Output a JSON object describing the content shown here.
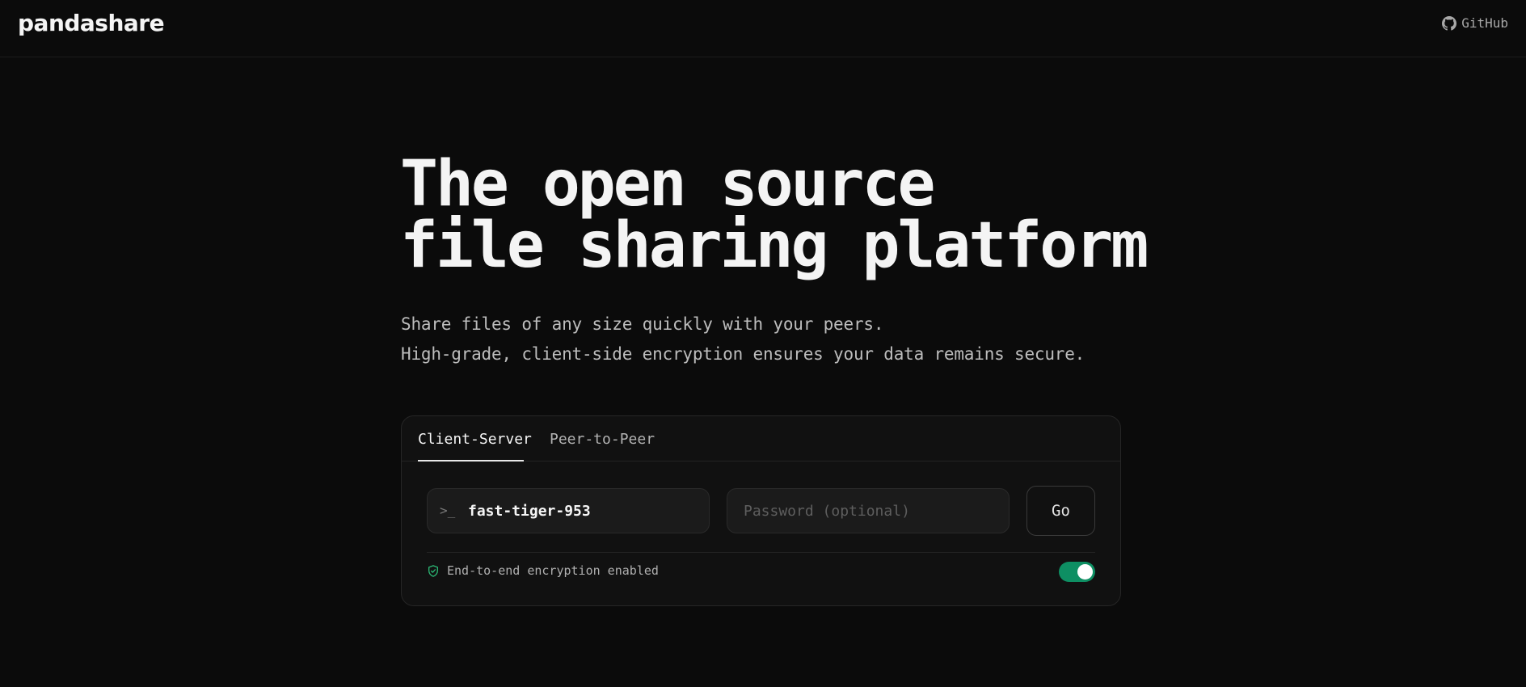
{
  "header": {
    "brand": "pandashare",
    "github_label": "GitHub",
    "github_icon": "github-icon"
  },
  "hero": {
    "title_line1": "The open source",
    "title_line2": "file sharing platform",
    "subtitle_line1": "Share files of any size quickly with your peers.",
    "subtitle_line2": "High-grade, client-side encryption ensures your data remains secure."
  },
  "card": {
    "tabs": [
      {
        "label": "Client-Server",
        "active": true
      },
      {
        "label": "Peer-to-Peer",
        "active": false
      }
    ],
    "code_field": {
      "icon": "terminal-prompt-icon",
      "prompt_glyph": ">_",
      "value": "fast-tiger-953"
    },
    "password_field": {
      "value": "",
      "placeholder": "Password (optional)"
    },
    "go_label": "Go",
    "encryption": {
      "icon": "shield-check-icon",
      "label": "End-to-end encryption enabled",
      "enabled": true
    }
  },
  "colors": {
    "background": "#0b0b0b",
    "accent_green": "#0e8f63",
    "shield_green": "#2bb673",
    "text_primary": "#f4f4f4",
    "text_muted": "#bdbdbd"
  }
}
